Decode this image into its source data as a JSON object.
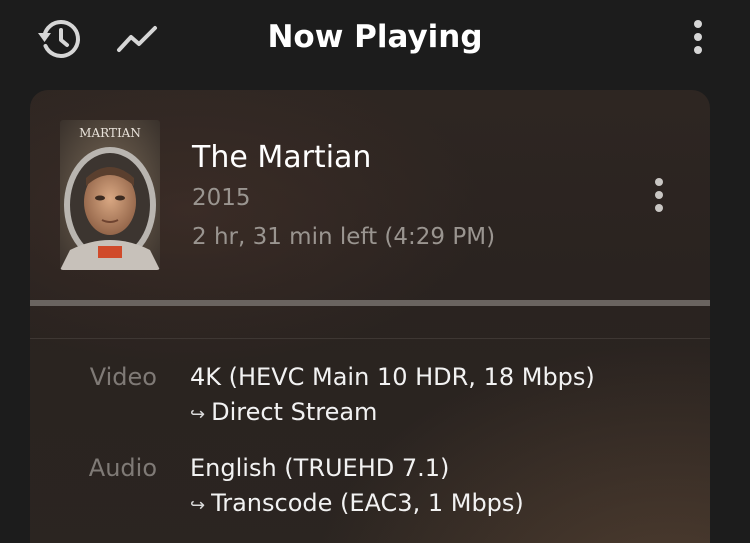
{
  "header": {
    "title": "Now Playing",
    "history_icon": "history-icon",
    "activity_icon": "activity-graph-icon",
    "more_icon": "more-vertical-icon"
  },
  "session": {
    "poster_text": "MARTIAN",
    "title": "The Martian",
    "year": "2015",
    "time_left": "2 hr, 31 min left (4:29 PM)",
    "more_icon": "more-vertical-icon",
    "progress_fraction": 0.0
  },
  "details": {
    "video_label": "Video",
    "video_value": "4K (HEVC Main 10 HDR, 18 Mbps)",
    "video_decision": "Direct Stream",
    "audio_label": "Audio",
    "audio_value": "English (TRUEHD 7.1)",
    "audio_decision": "Transcode (EAC3, 1 Mbps)",
    "arrow_glyph": "↪"
  },
  "colors": {
    "accent": "#e5a00d",
    "background": "#1c1c1c",
    "secondary_text": "#9a9590"
  }
}
